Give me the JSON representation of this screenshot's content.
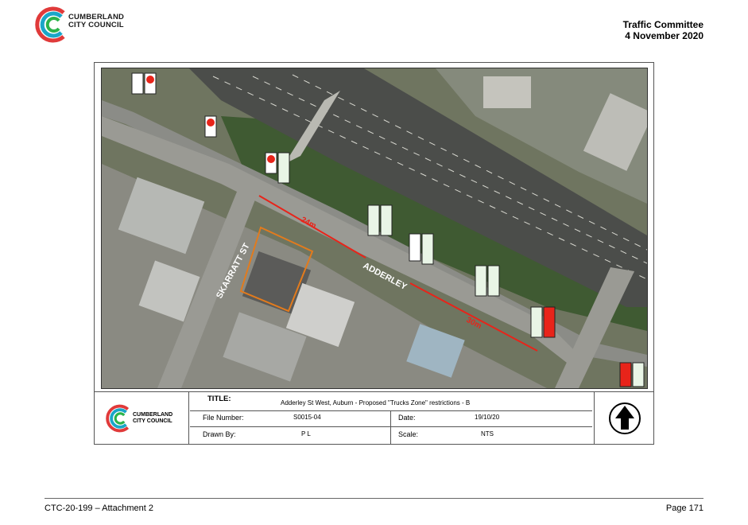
{
  "header": {
    "logo_line1": "CUMBERLAND",
    "logo_line2": "CITY COUNCIL",
    "committee": "Traffic Committee",
    "date": "4 November 2020"
  },
  "map": {
    "street_label_1": "SKARRATT ST",
    "street_label_2": "ADDERLEY",
    "distance_1": "24m",
    "distance_2": "30m",
    "colors": {
      "restriction": "#e8241a",
      "property": "#e27b1d"
    }
  },
  "title_block": {
    "logo_line1": "CUMBERLAND",
    "logo_line2": "CITY COUNCIL",
    "title_label": "TITLE:",
    "title_value": "Adderley St West, Auburn - Proposed \"Trucks Zone\" restrictions - B",
    "file_label": "File Number:",
    "file_value": "S0015-04",
    "date_label": "Date:",
    "date_value": "19/10/20",
    "drawn_label": "Drawn By:",
    "drawn_value": "P L",
    "scale_label": "Scale:",
    "scale_value": "NTS"
  },
  "footer": {
    "left": "CTC-20-199 – Attachment 2",
    "right": "Page 171"
  }
}
